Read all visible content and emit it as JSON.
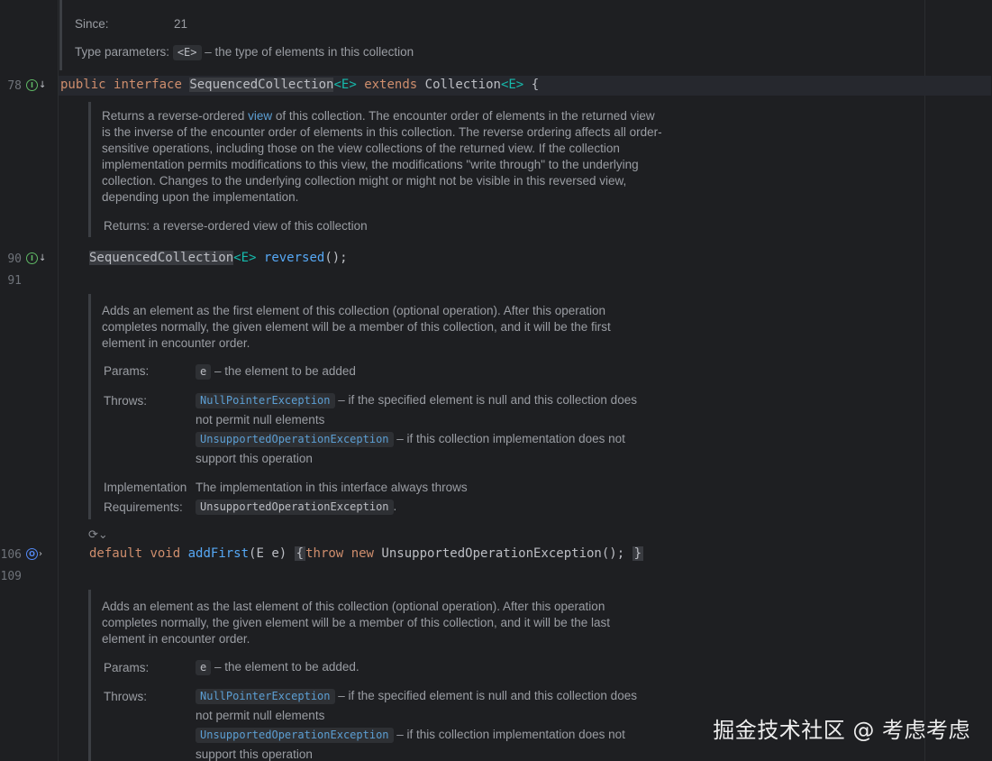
{
  "gutter": {
    "lines": [
      "78",
      "90",
      "91",
      "106",
      "109"
    ]
  },
  "top_doc": {
    "since_label": "Since:",
    "since_value": "21",
    "type_params_label": "Type parameters:",
    "type_param_tag": "<E>",
    "type_param_desc": "– the type of elements in this collection"
  },
  "code_interface": {
    "kw_public": "public",
    "kw_interface": "interface",
    "name": "SequencedCollection",
    "generic": "<E>",
    "kw_extends": "extends",
    "parent": "Collection",
    "parent_generic": "<E>",
    "brace": "{"
  },
  "reversed_doc": {
    "text_before_link": "Returns a reverse-ordered ",
    "link": "view",
    "text_after_link": " of this collection. The encounter order of elements in the returned view is the inverse of the encounter order of elements in this collection. The reverse ordering affects all order-sensitive operations, including those on the view collections of the returned view. If the collection implementation permits modifications to this view, the modifications \"write through\" to the underlying collection. Changes to the underlying collection might or might not be visible in this reversed view, depending upon the implementation.",
    "returns": "Returns: a reverse-ordered view of this collection"
  },
  "code_reversed": {
    "type": "SequencedCollection",
    "generic": "<E>",
    "method": "reversed",
    "rest": "();"
  },
  "addfirst_doc": {
    "summary": "Adds an element as the first element of this collection (optional operation). After this operation completes normally, the given element will be a member of this collection, and it will be the first element in encounter order.",
    "params_label": "Params:",
    "param_tag": "e",
    "param_desc": "– the element to be added",
    "throws_label": "Throws:",
    "throw1_tag": "NullPointerException",
    "throw1_desc": "– if the specified element is null and this collection does",
    "throw1_desc2": "not permit null elements",
    "throw2_tag": "UnsupportedOperationException",
    "throw2_desc": "– if this collection implementation does not",
    "throw2_desc2": "support this operation",
    "impl_label1": "Implementation",
    "impl_label2": "Requirements:",
    "impl_text": "The implementation in this interface always throws",
    "impl_tag": "UnsupportedOperationException",
    "impl_end": "."
  },
  "code_addfirst": {
    "kw_default": "default",
    "kw_void": "void",
    "method": "addFirst",
    "paren_open": "(",
    "param_type": "E",
    "param_name": "e)",
    "brace_open": "{",
    "kw_throw": "throw",
    "kw_new": "new",
    "exception": "UnsupportedOperationException();",
    "brace_close": "}"
  },
  "addlast_doc": {
    "summary": "Adds an element as the last element of this collection (optional operation). After this operation completes normally, the given element will be a member of this collection, and it will be the last element in encounter order.",
    "params_label": "Params:",
    "param_tag": "e",
    "param_desc": "– the element to be added.",
    "throws_label": "Throws:",
    "throw1_tag": "NullPointerException",
    "throw1_desc": "– if the specified element is null and this collection does",
    "throw1_desc2": "not permit null elements",
    "throw2_tag": "UnsupportedOperationException",
    "throw2_desc": "– if this collection implementation does not",
    "throw2_desc2": "support this operation"
  },
  "watermark": "掘金技术社区 @ 考虑考虑"
}
